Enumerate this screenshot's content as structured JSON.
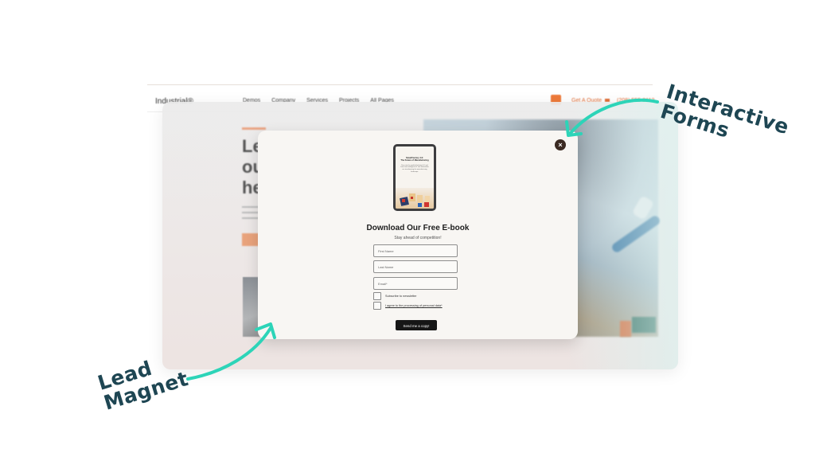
{
  "website": {
    "logo": "Industrial®",
    "nav_links": [
      "Demos",
      "Company",
      "Services",
      "Projects",
      "All Pages"
    ],
    "quote_label": "Get A Quote",
    "phone": "(208) 555-0112",
    "hero_heading_partial": [
      "Le",
      "ou",
      "he"
    ]
  },
  "modal": {
    "ebook_cover": {
      "title_line1": "SmartFactory 4.0:",
      "title_line2": "The Future of Manufacturing",
      "body": "Dive into the world of Industry 4.0 and learn how intelligent IoT and automation are transforming the manufacturing landscape."
    },
    "title": "Download Our Free E-book",
    "subtitle": "Stay ahead of competition!",
    "fields": {
      "first_name_placeholder": "First Name",
      "last_name_placeholder": "Last Name",
      "email_placeholder": "Email*"
    },
    "checkboxes": {
      "newsletter_label": "Subscribe to newsletter",
      "consent_label": "I agree to the processing of personal data*"
    },
    "submit_label": "Send me a copy!",
    "close_icon": "×"
  },
  "annotations": {
    "forms_line1": "Interactive",
    "forms_line2": "Forms",
    "lead_line1": "Lead",
    "lead_line2": "Magnet",
    "arrow_color": "#2dd4b8",
    "text_color": "#1e4653"
  }
}
